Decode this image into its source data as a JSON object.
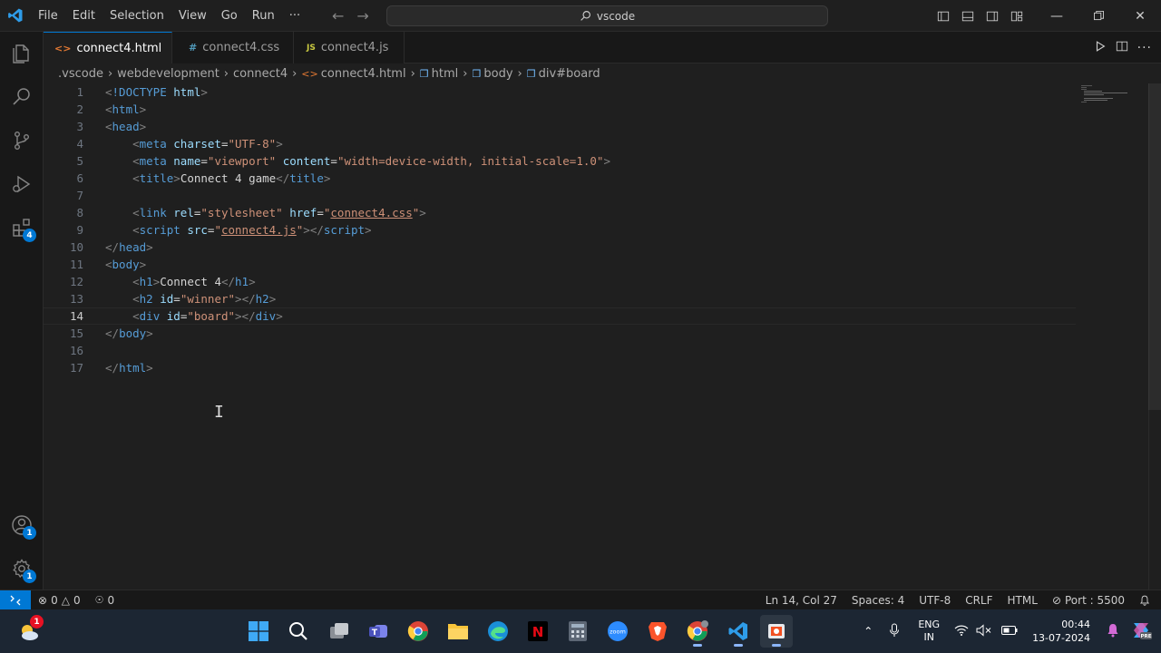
{
  "titlebar": {
    "menu": [
      "File",
      "Edit",
      "Selection",
      "View",
      "Go",
      "Run",
      "···"
    ],
    "search": "vscode"
  },
  "activity": {
    "extensions_badge": "4",
    "accounts_badge": "1",
    "settings_badge": "1"
  },
  "tabs": [
    {
      "label": "connect4.html",
      "icon": "<>",
      "icon_color": "#e37933",
      "active": true
    },
    {
      "label": "connect4.css",
      "icon": "#",
      "icon_color": "#519aba",
      "active": false
    },
    {
      "label": "connect4.js",
      "icon": "JS",
      "icon_color": "#cbcb41",
      "active": false
    }
  ],
  "breadcrumb": [
    ".vscode",
    "webdevelopment",
    "connect4",
    "connect4.html",
    "html",
    "body",
    "div#board"
  ],
  "editor": {
    "line_numbers": [
      "1",
      "2",
      "3",
      "4",
      "5",
      "6",
      "7",
      "8",
      "9",
      "10",
      "11",
      "12",
      "13",
      "14",
      "15",
      "16",
      "17"
    ],
    "current_line": 14
  },
  "code": {
    "l1_doctype": "!DOCTYPE",
    "l1_html": "html",
    "tag_html": "html",
    "tag_head": "head",
    "tag_meta": "meta",
    "attr_charset": "charset",
    "val_utf8": "\"UTF-8\"",
    "attr_name": "name",
    "val_viewport": "\"viewport\"",
    "attr_content": "content",
    "val_content": "\"width=device-width, initial-scale=1.0\"",
    "tag_title": "title",
    "title_text": "Connect 4 game",
    "tag_link": "link",
    "attr_rel": "rel",
    "val_stylesheet": "\"stylesheet\"",
    "attr_href": "href",
    "val_css": "connect4.css",
    "tag_script": "script",
    "attr_src": "src",
    "val_js": "connect4.js",
    "tag_body": "body",
    "tag_h1": "h1",
    "h1_text": "Connect 4",
    "tag_h2": "h2",
    "attr_id": "id",
    "val_winner": "\"winner\"",
    "tag_div": "div",
    "val_board": "\"board\""
  },
  "status": {
    "errors": "0",
    "warnings": "0",
    "ports": "0",
    "position": "Ln 14, Col 27",
    "spaces": "Spaces: 4",
    "encoding": "UTF-8",
    "eol": "CRLF",
    "language": "HTML",
    "port": "Port : 5500"
  },
  "taskbar": {
    "weather_badge": "1",
    "lang_line1": "ENG",
    "lang_line2": "IN",
    "time": "00:44",
    "date": "13-07-2024",
    "zoom_label": "zoom",
    "copilot_label": "PRE"
  }
}
